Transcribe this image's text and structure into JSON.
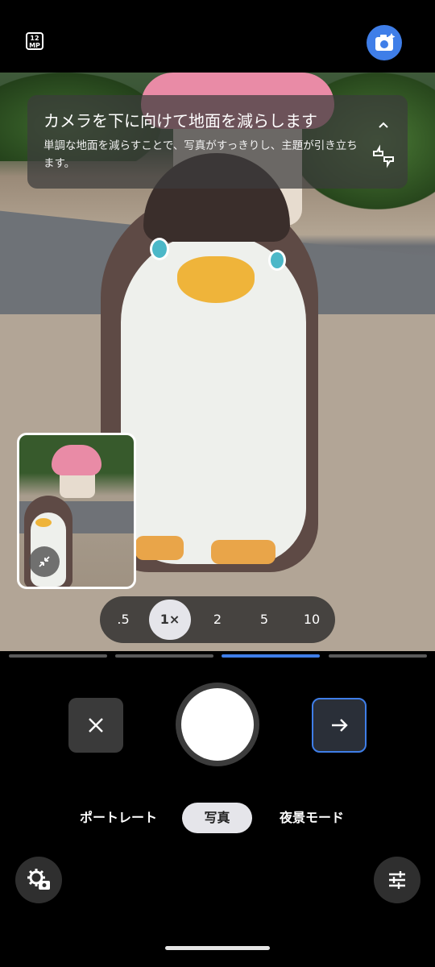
{
  "status": {
    "megapixel_badge_top": "12",
    "megapixel_badge_bottom": "MP"
  },
  "tip": {
    "title": "カメラを下に向けて地面を減らします",
    "body": "単調な地面を減らすことで、写真がすっきりし、主題が引き立ちます。"
  },
  "zoom": {
    "options": [
      ".5",
      "1×",
      "2",
      "5",
      "10"
    ],
    "selected": "1×"
  },
  "modes": {
    "items": [
      "ポートレート",
      "写真",
      "夜景モード"
    ],
    "selected": "写真"
  },
  "page_indicator": {
    "count": 4,
    "active_index": 2
  },
  "colors": {
    "accent": "#3f7ee8",
    "background": "#000000"
  },
  "icons": {
    "lens": "camera-sparkle-icon",
    "close": "close-icon",
    "next": "arrow-right-icon",
    "settings": "camera-settings-icon",
    "adjust": "sliders-icon",
    "collapse": "collapse-arrows-icon",
    "feedback": "thumbs-feedback-icon",
    "expand": "chevron-up-icon"
  }
}
